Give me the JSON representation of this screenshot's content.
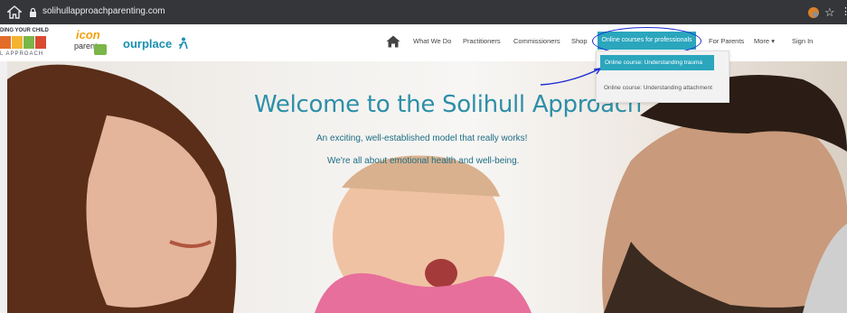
{
  "browser": {
    "url": "solihullapproachparenting.com",
    "icons": [
      "home-icon",
      "lock-icon",
      "extension-icon",
      "star-icon"
    ]
  },
  "header": {
    "logo_solihull_top": "DING YOUR CHILD",
    "logo_solihull_bottom": "L APPROACH",
    "logo_icon_top": "icon",
    "logo_icon_bottom": "parent",
    "logo_ourplace": "ourplace",
    "nav": {
      "what_we_do": "What We Do",
      "practitioners": "Practitioners",
      "commissioners": "Commissioners",
      "shop": "Shop",
      "online_courses": "Online courses for professionals",
      "for_parents": "For Parents",
      "more": "More",
      "sign_in": "Sign In"
    }
  },
  "dropdown": {
    "items": [
      "Online course: Understanding trauma",
      "Online course: Understanding attachment"
    ]
  },
  "hero": {
    "title": "Welcome to the Solihull Approach",
    "subtitle1": "An exciting, well-established model that really works!",
    "subtitle2": "We're all about emotional health and well-being."
  },
  "colors": {
    "accent": "#2aa6bd",
    "title": "#2d8fa8",
    "annotation": "#1d2bd4"
  }
}
